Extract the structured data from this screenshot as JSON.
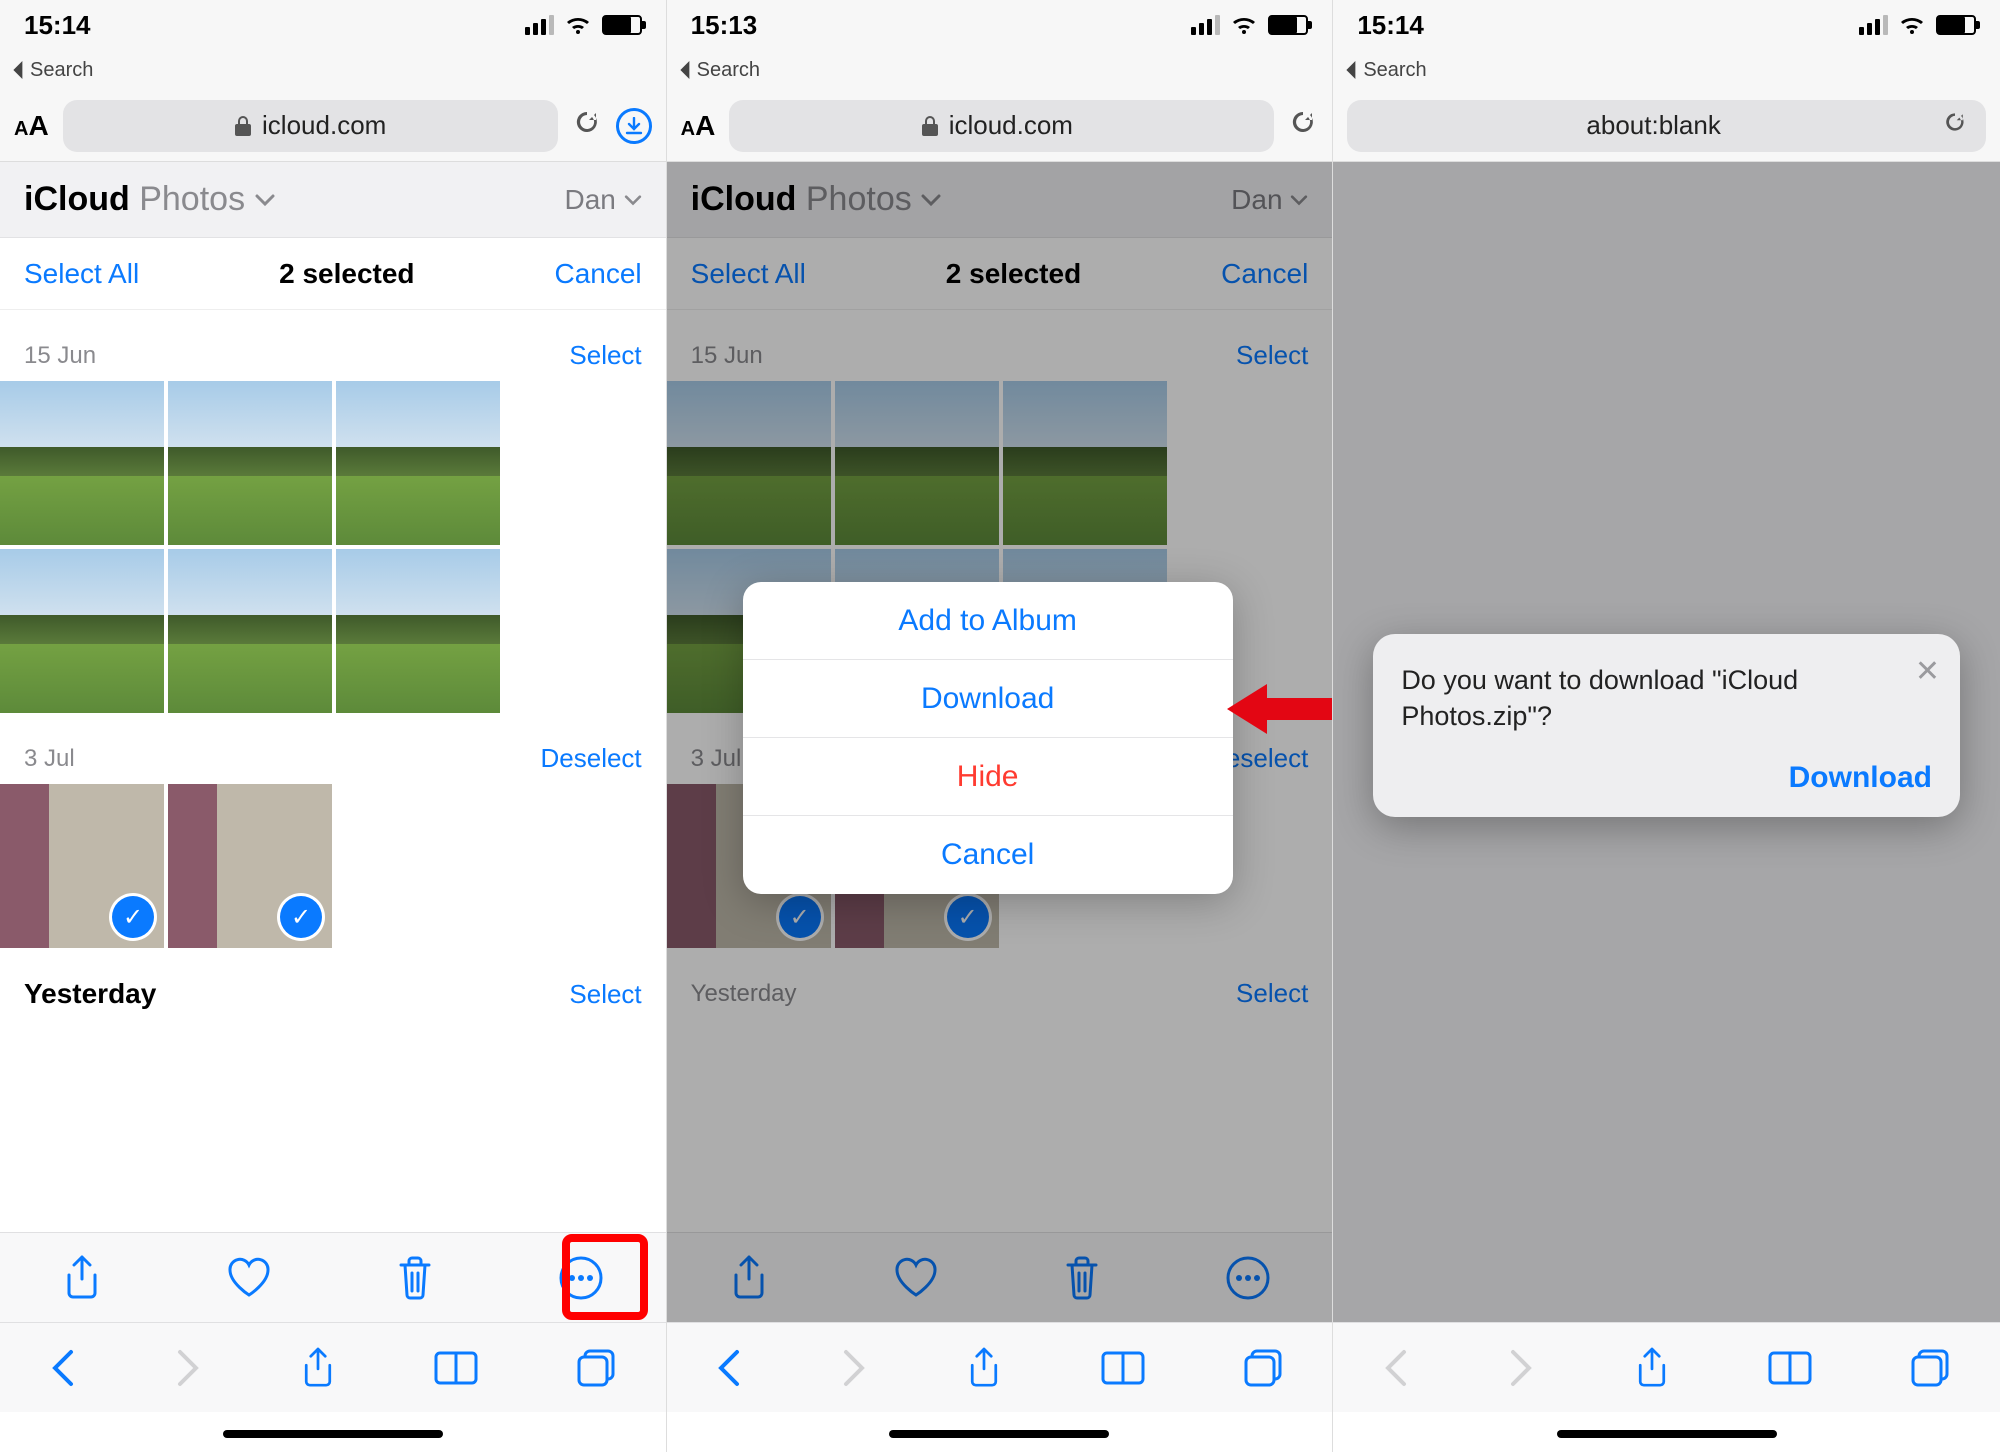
{
  "screens": [
    {
      "status": {
        "time": "15:14",
        "back_label": "Search"
      },
      "url": {
        "domain": "icloud.com",
        "show_aa": true,
        "show_download": true
      },
      "header": {
        "brand": "iCloud",
        "section": "Photos",
        "user": "Dan"
      },
      "selbar": {
        "select_all": "Select All",
        "count": "2 selected",
        "cancel": "Cancel"
      },
      "sections": [
        {
          "date": "15 Jun",
          "action": "Select",
          "thumbs": 6,
          "kind": "landscape"
        },
        {
          "date": "3 Jul",
          "action": "Deselect",
          "thumbs": 2,
          "kind": "cat",
          "checked": true
        },
        {
          "date": "Yesterday",
          "action": "Select",
          "thumbs": 0,
          "kind": "none"
        }
      ],
      "highlight_more": true
    },
    {
      "status": {
        "time": "15:13",
        "back_label": "Search"
      },
      "url": {
        "domain": "icloud.com",
        "show_aa": true,
        "show_download": false
      },
      "header": {
        "brand": "iCloud",
        "section": "Photos",
        "user": "Dan"
      },
      "selbar": {
        "select_all": "Select All",
        "count": "2 selected",
        "cancel": "Cancel"
      },
      "sections": [
        {
          "date": "15 Jun",
          "action": "Select",
          "thumbs": 6,
          "kind": "landscape"
        },
        {
          "date": "3 Jul · The Avenue",
          "action": "Deselect",
          "thumbs": 2,
          "kind": "cat",
          "checked": true
        },
        {
          "date": "Yesterday",
          "action": "Select",
          "thumbs": 0,
          "kind": "none"
        }
      ],
      "action_sheet": {
        "items": [
          {
            "label": "Add to Album",
            "style": "norm"
          },
          {
            "label": "Download",
            "style": "norm"
          },
          {
            "label": "Hide",
            "style": "danger"
          },
          {
            "label": "Cancel",
            "style": "norm"
          }
        ]
      },
      "arrow_points_to": "Download"
    },
    {
      "status": {
        "time": "15:14",
        "back_label": "Search"
      },
      "url": {
        "domain": "about:blank",
        "show_aa": false,
        "show_download": false,
        "plain": true
      },
      "blank": true,
      "dialog": {
        "message": "Do you want to download \"iCloud Photos.zip\"?",
        "confirm": "Download"
      }
    }
  ]
}
